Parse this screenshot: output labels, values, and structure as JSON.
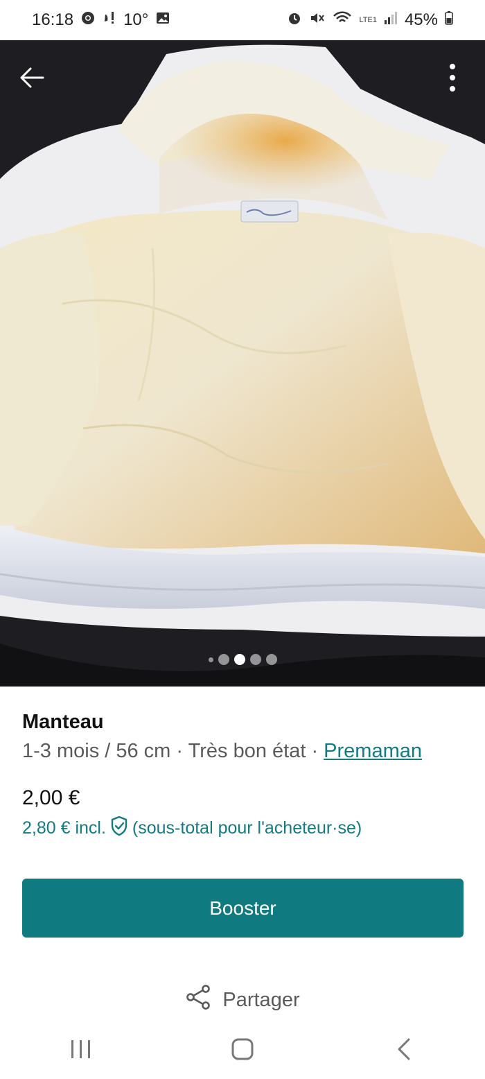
{
  "status_bar": {
    "time": "16:18",
    "temperature": "10°",
    "battery": "45%",
    "network": "LTE1"
  },
  "listing": {
    "title": "Manteau",
    "size_condition": "1-3 mois / 56 cm · Très bon état · ",
    "brand": "Premaman",
    "price": "2,00 €",
    "buyer_price": "2,80 € incl.",
    "buyer_price_note": "(sous-total pour l'acheteur·se)",
    "photo_count": 5,
    "current_photo_index": 2
  },
  "actions": {
    "boost_label": "Booster",
    "share_label": "Partager"
  },
  "colors": {
    "accent": "#0f7a80",
    "link": "#137b82"
  },
  "icons": {
    "back": "arrow-left-icon",
    "more": "more-vertical-icon",
    "shield": "shield-check-icon",
    "share": "share-icon"
  }
}
